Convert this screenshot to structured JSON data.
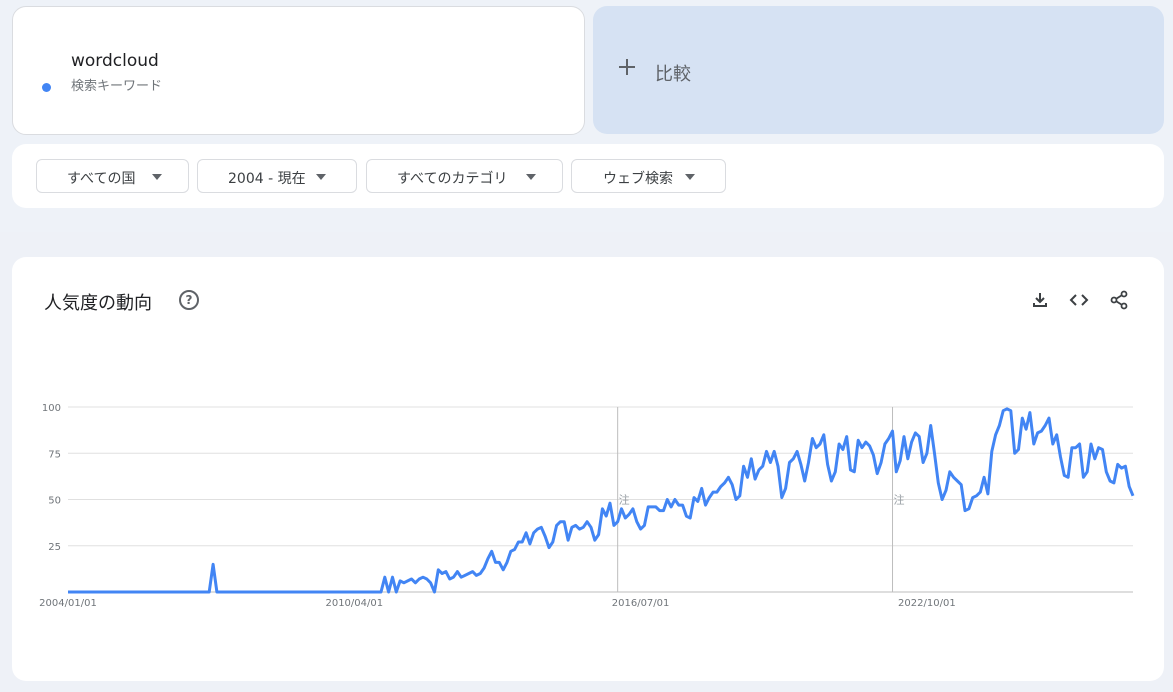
{
  "term": {
    "name": "wordcloud",
    "subtitle": "検索キーワード",
    "color": "#4285f4"
  },
  "compare": {
    "label": "比較",
    "icon": "plus-icon"
  },
  "filters": [
    {
      "label": "すべての国",
      "icon": "caret-down-icon"
    },
    {
      "label": "2004 - 現在",
      "icon": "caret-down-icon"
    },
    {
      "label": "すべてのカテゴリ",
      "icon": "caret-down-icon"
    },
    {
      "label": "ウェブ検索",
      "icon": "caret-down-icon"
    }
  ],
  "chart_panel": {
    "title": "人気度の動向",
    "help_icon": "help-circle-icon",
    "actions": [
      "download-icon",
      "embed-code-icon",
      "share-icon"
    ]
  },
  "chart_data": {
    "type": "line",
    "title": "",
    "xlabel": "",
    "ylabel": "",
    "ylim": [
      0,
      100
    ],
    "y_ticks": [
      25,
      50,
      75,
      100
    ],
    "x_ticks": [
      "2004/01/01",
      "2010/04/01",
      "2016/07/01",
      "2022/10/01"
    ],
    "grid": true,
    "annotations": [
      {
        "x": "2016/01",
        "label": "注"
      },
      {
        "x": "2022/01",
        "label": "注"
      }
    ],
    "series": [
      {
        "color": "#4285f4",
        "x_start": "2004/01",
        "x_step": "month",
        "values": [
          0,
          0,
          0,
          0,
          0,
          0,
          0,
          0,
          0,
          0,
          0,
          0,
          0,
          0,
          0,
          0,
          0,
          0,
          0,
          0,
          0,
          0,
          0,
          0,
          0,
          0,
          0,
          0,
          0,
          0,
          0,
          0,
          0,
          0,
          0,
          0,
          0,
          0,
          15,
          0,
          0,
          0,
          0,
          0,
          0,
          0,
          0,
          0,
          0,
          0,
          0,
          0,
          0,
          0,
          0,
          0,
          0,
          0,
          0,
          0,
          0,
          0,
          0,
          0,
          0,
          0,
          0,
          0,
          0,
          0,
          0,
          0,
          0,
          0,
          0,
          0,
          0,
          0,
          0,
          0,
          0,
          0,
          0,
          8,
          0,
          8,
          0,
          6,
          5,
          6,
          7,
          5,
          7,
          8,
          7,
          5,
          0,
          12,
          10,
          11,
          7,
          8,
          11,
          8,
          9,
          10,
          11,
          9,
          10,
          13,
          18,
          22,
          16,
          16,
          12,
          16,
          22,
          23,
          27,
          27,
          32,
          26,
          32,
          34,
          35,
          30,
          24,
          27,
          36,
          38,
          38,
          28,
          35,
          36,
          34,
          35,
          38,
          35,
          28,
          31,
          45,
          41,
          48,
          36,
          38,
          45,
          40,
          42,
          45,
          38,
          34,
          36,
          46,
          46,
          46,
          44,
          44,
          50,
          46,
          50,
          47,
          47,
          41,
          40,
          51,
          49,
          56,
          47,
          51,
          54,
          54,
          57,
          59,
          62,
          58,
          50,
          52,
          68,
          62,
          72,
          61,
          66,
          68,
          76,
          70,
          76,
          68,
          51,
          56,
          70,
          72,
          76,
          69,
          60,
          70,
          83,
          78,
          80,
          85,
          69,
          60,
          65,
          80,
          77,
          84,
          66,
          65,
          82,
          78,
          81,
          79,
          74,
          64,
          70,
          80,
          83,
          87,
          65,
          71,
          84,
          72,
          81,
          86,
          84,
          70,
          75,
          90,
          75,
          59,
          50,
          55,
          65,
          62,
          60,
          58,
          44,
          45,
          51,
          52,
          54,
          62,
          53,
          76,
          85,
          90,
          98,
          99,
          98,
          75,
          77,
          94,
          88,
          97,
          80,
          86,
          87,
          90,
          94,
          80,
          85,
          73,
          63,
          62,
          78,
          78,
          80,
          62,
          65,
          80,
          72,
          78,
          77,
          65,
          60,
          59,
          69,
          67,
          68,
          57,
          52
        ]
      }
    ]
  }
}
